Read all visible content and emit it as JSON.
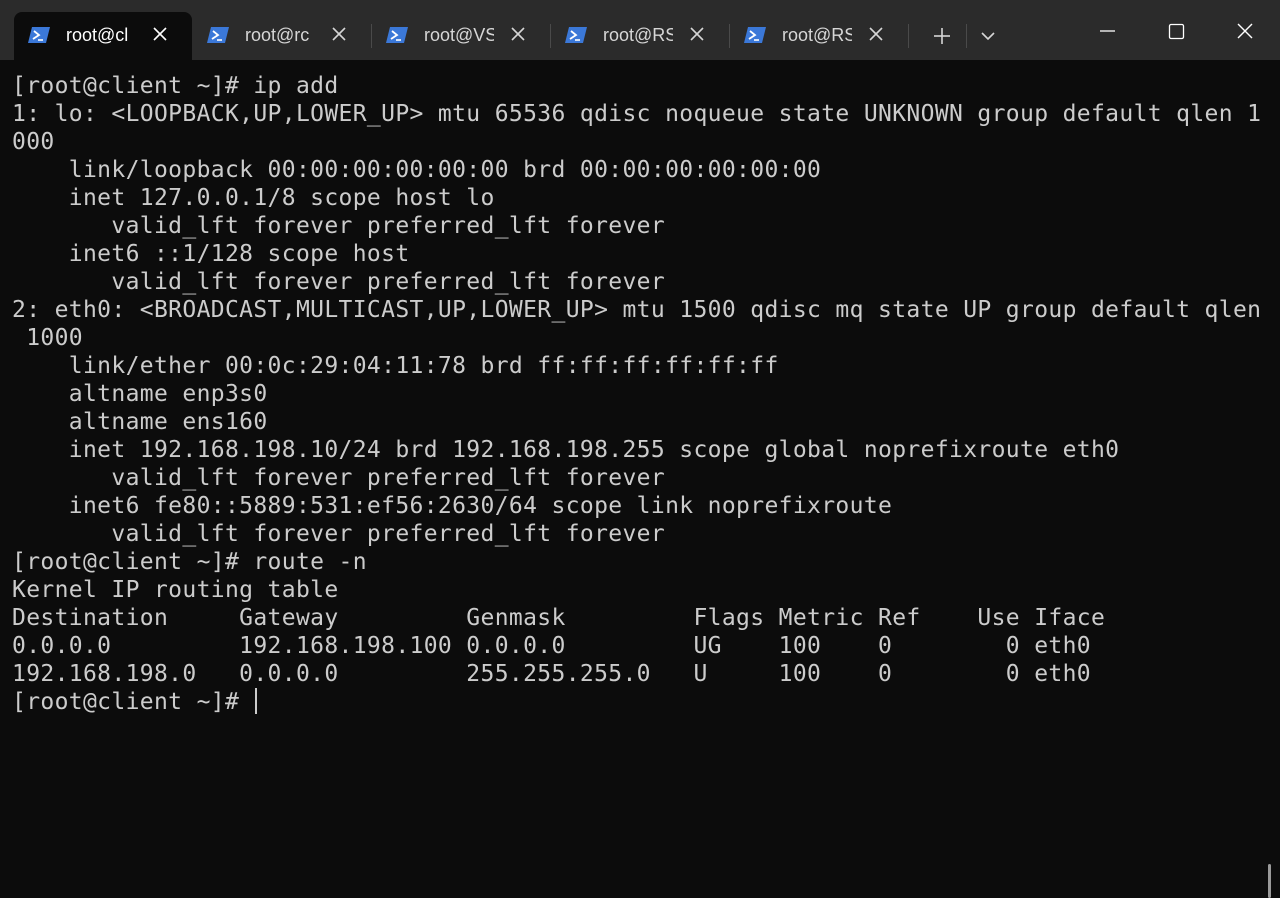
{
  "titlebar": {
    "tabs": [
      {
        "label": "root@cl",
        "active": true
      },
      {
        "label": "root@rc",
        "active": false
      },
      {
        "label": "root@VS",
        "active": false
      },
      {
        "label": "root@RS",
        "active": false
      },
      {
        "label": "root@RS",
        "active": false
      }
    ],
    "icons": {
      "tab_icon": "powershell-icon",
      "close": "close-icon",
      "new_tab": "plus-icon",
      "dropdown": "chevron-down-icon",
      "minimize": "minimize-icon",
      "maximize": "maximize-icon",
      "window_close": "close-icon"
    },
    "colors": {
      "titlebar_bg": "#2b2b2b",
      "tab_icon": "#3b78d8"
    }
  },
  "terminal": {
    "lines": [
      "[root@client ~]# ip add",
      "1: lo: <LOOPBACK,UP,LOWER_UP> mtu 65536 qdisc noqueue state UNKNOWN group default qlen 1",
      "000",
      "    link/loopback 00:00:00:00:00:00 brd 00:00:00:00:00:00",
      "    inet 127.0.0.1/8 scope host lo",
      "       valid_lft forever preferred_lft forever",
      "    inet6 ::1/128 scope host",
      "       valid_lft forever preferred_lft forever",
      "2: eth0: <BROADCAST,MULTICAST,UP,LOWER_UP> mtu 1500 qdisc mq state UP group default qlen",
      " 1000",
      "    link/ether 00:0c:29:04:11:78 brd ff:ff:ff:ff:ff:ff",
      "    altname enp3s0",
      "    altname ens160",
      "    inet 192.168.198.10/24 brd 192.168.198.255 scope global noprefixroute eth0",
      "       valid_lft forever preferred_lft forever",
      "    inet6 fe80::5889:531:ef56:2630/64 scope link noprefixroute",
      "       valid_lft forever preferred_lft forever",
      "[root@client ~]# route -n",
      "Kernel IP routing table",
      "Destination     Gateway         Genmask         Flags Metric Ref    Use Iface",
      "0.0.0.0         192.168.198.100 0.0.0.0         UG    100    0        0 eth0",
      "192.168.198.0   0.0.0.0         255.255.255.0   U     100    0        0 eth0"
    ],
    "prompt": "[root@client ~]# ",
    "colors": {
      "bg": "#0c0c0c",
      "fg": "#cccccc"
    }
  }
}
